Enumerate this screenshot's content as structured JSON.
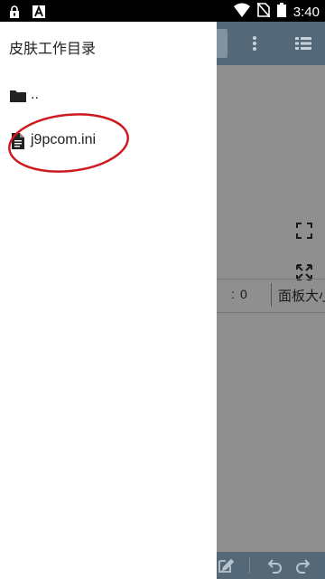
{
  "status_bar": {
    "time": "3:40",
    "icons": [
      "lock-icon",
      "a-notification-icon",
      "wifi-icon",
      "no-sim-icon",
      "battery-icon"
    ]
  },
  "drawer": {
    "title": "皮肤工作目录",
    "items": [
      {
        "label": "..",
        "icon": "folder-icon"
      },
      {
        "label": "j9pcom.ini",
        "icon": "file-icon"
      }
    ]
  },
  "background_app": {
    "info_label": ":",
    "info_value": "0",
    "panel_label": "面板大小",
    "toolbar_icons": [
      "more-vert-icon",
      "list-icon"
    ],
    "content_icons": [
      "fullscreen-icon",
      "expand-icon"
    ],
    "bottom_icons": [
      "edit-icon",
      "undo-icon",
      "redo-icon"
    ]
  },
  "colors": {
    "toolbar": "#556878",
    "overlay_gray": "#8f8f8f",
    "drawer_bg": "#ffffff",
    "annotation_ring": "#d0191e"
  }
}
